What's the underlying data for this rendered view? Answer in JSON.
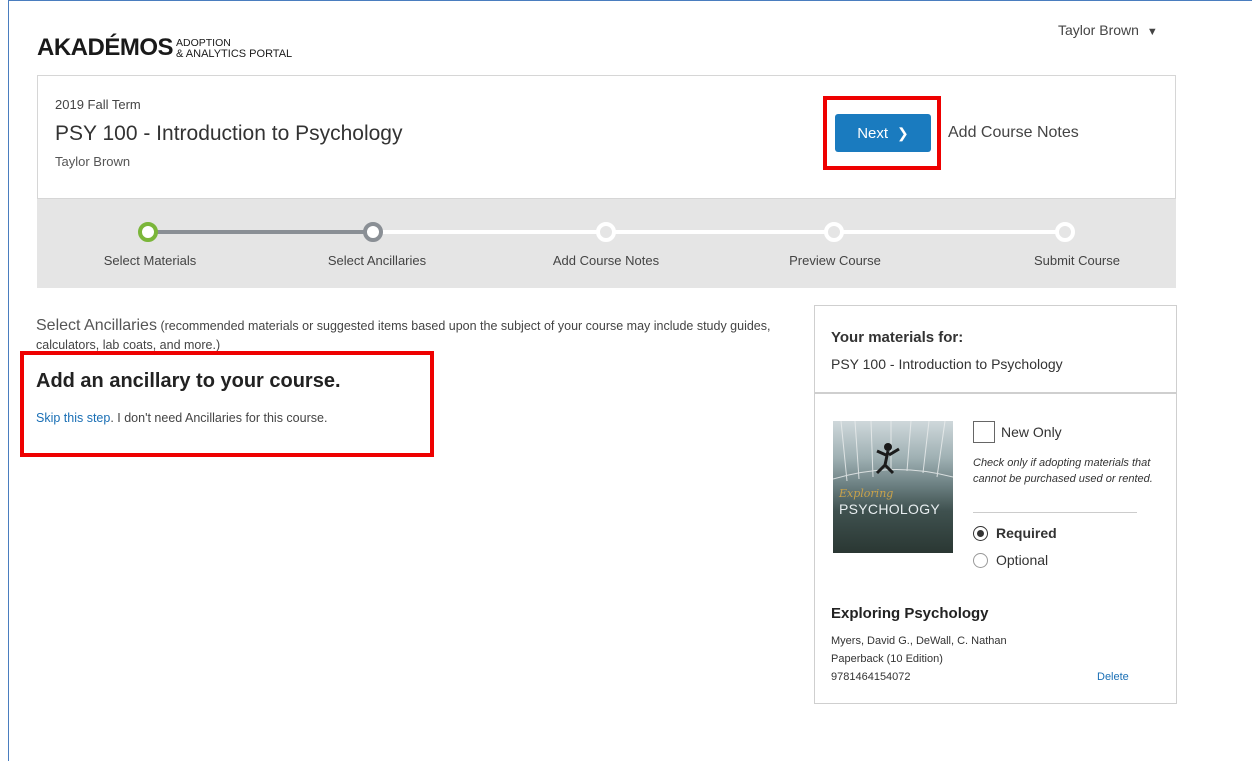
{
  "brand": {
    "name_main": "AKADÉMOS",
    "name_sub_1": "ADOPTION",
    "name_sub_2": "& ANALYTICS PORTAL"
  },
  "user": {
    "name": "Taylor Brown",
    "caret": "▼"
  },
  "course": {
    "term": "2019 Fall Term",
    "title": "PSY 100 - Introduction to Psychology",
    "instructor": "Taylor Brown",
    "next_label": "Next",
    "next_chevron": "❯",
    "add_notes_label": "Add Course Notes"
  },
  "steps": [
    {
      "label": "Select Materials",
      "state": "complete"
    },
    {
      "label": "Select Ancillaries",
      "state": "current"
    },
    {
      "label": "Add Course Notes",
      "state": "upcoming"
    },
    {
      "label": "Preview Course",
      "state": "upcoming"
    },
    {
      "label": "Submit Course",
      "state": "upcoming"
    }
  ],
  "ancillaries": {
    "lead": "Select Ancillaries",
    "description": "(recommended materials or suggested items based upon the subject of your course may include study guides, calculators, lab coats, and more.)",
    "heading": "Add an ancillary to your course.",
    "skip_link": "Skip this step",
    "skip_rest": ". I don't need Ancillaries for this course."
  },
  "materials": {
    "header": "Your materials for:",
    "course": "PSY 100 - Introduction to Psychology",
    "cover_script": "Exploring",
    "cover_title": "PSYCHOLOGY",
    "new_only_label": "New Only",
    "new_only_note": "Check only if adopting materials that cannot be purchased used or rented.",
    "required_label": "Required",
    "optional_label": "Optional",
    "selected": "Required",
    "book_title": "Exploring Psychology",
    "authors": "Myers, David G., DeWall, C. Nathan",
    "format": "Paperback (10 Edition)",
    "isbn": "9781464154072",
    "delete_label": "Delete"
  },
  "colors": {
    "accent": "#1a7bbf",
    "complete": "#7bb63a",
    "current": "#8a8f95",
    "highlight": "#ee0000"
  }
}
